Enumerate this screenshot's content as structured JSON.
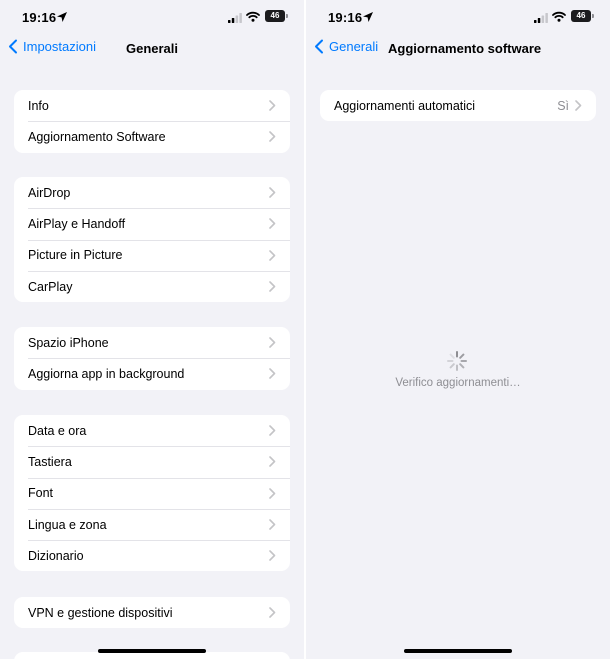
{
  "status_bar": {
    "time": "19:16",
    "battery": "46"
  },
  "left": {
    "nav": {
      "back_label": "Impostazioni",
      "title": "Generali"
    },
    "groups": [
      {
        "items": [
          "Info",
          "Aggiornamento Software"
        ]
      },
      {
        "items": [
          "AirDrop",
          "AirPlay e Handoff",
          "Picture in Picture",
          "CarPlay"
        ]
      },
      {
        "items": [
          "Spazio iPhone",
          "Aggiorna app in background"
        ]
      },
      {
        "items": [
          "Data e ora",
          "Tastiera",
          "Font",
          "Lingua e zona",
          "Dizionario"
        ]
      },
      {
        "items": [
          "VPN e gestione dispositivi"
        ]
      }
    ]
  },
  "right": {
    "nav": {
      "back_label": "Generali",
      "title": "Aggiornamento software"
    },
    "auto_updates": {
      "label": "Aggiornamenti automatici",
      "value": "Sì"
    },
    "loading_text": "Verifico aggiornamenti…"
  },
  "colors": {
    "accent": "#007aff",
    "background": "#f2f2f7",
    "secondary_text": "#8e8e93"
  },
  "icons": [
    "location-arrow-icon",
    "cellular-signal-icon",
    "wifi-icon",
    "battery-icon",
    "chevron-left-icon",
    "chevron-right-icon",
    "activity-spinner-icon"
  ]
}
